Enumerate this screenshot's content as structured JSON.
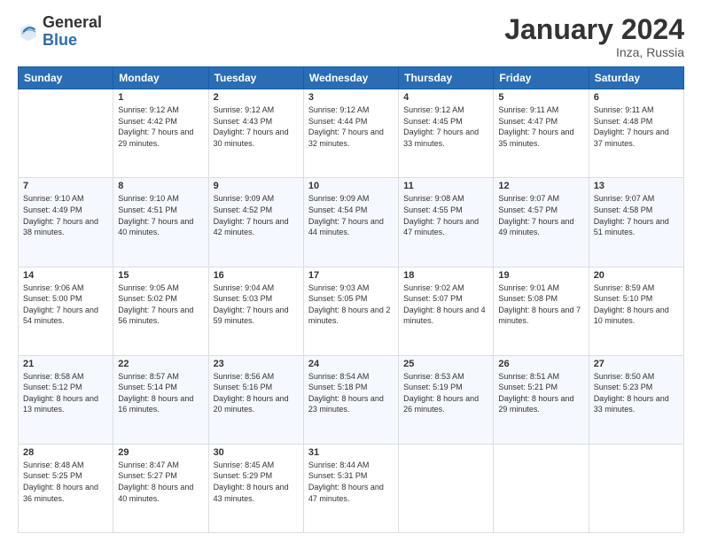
{
  "logo": {
    "general": "General",
    "blue": "Blue"
  },
  "header": {
    "month": "January 2024",
    "location": "Inza, Russia"
  },
  "weekdays": [
    "Sunday",
    "Monday",
    "Tuesday",
    "Wednesday",
    "Thursday",
    "Friday",
    "Saturday"
  ],
  "weeks": [
    [
      {
        "day": "",
        "sunrise": "",
        "sunset": "",
        "daylight": ""
      },
      {
        "day": "1",
        "sunrise": "Sunrise: 9:12 AM",
        "sunset": "Sunset: 4:42 PM",
        "daylight": "Daylight: 7 hours and 29 minutes."
      },
      {
        "day": "2",
        "sunrise": "Sunrise: 9:12 AM",
        "sunset": "Sunset: 4:43 PM",
        "daylight": "Daylight: 7 hours and 30 minutes."
      },
      {
        "day": "3",
        "sunrise": "Sunrise: 9:12 AM",
        "sunset": "Sunset: 4:44 PM",
        "daylight": "Daylight: 7 hours and 32 minutes."
      },
      {
        "day": "4",
        "sunrise": "Sunrise: 9:12 AM",
        "sunset": "Sunset: 4:45 PM",
        "daylight": "Daylight: 7 hours and 33 minutes."
      },
      {
        "day": "5",
        "sunrise": "Sunrise: 9:11 AM",
        "sunset": "Sunset: 4:47 PM",
        "daylight": "Daylight: 7 hours and 35 minutes."
      },
      {
        "day": "6",
        "sunrise": "Sunrise: 9:11 AM",
        "sunset": "Sunset: 4:48 PM",
        "daylight": "Daylight: 7 hours and 37 minutes."
      }
    ],
    [
      {
        "day": "7",
        "sunrise": "Sunrise: 9:10 AM",
        "sunset": "Sunset: 4:49 PM",
        "daylight": "Daylight: 7 hours and 38 minutes."
      },
      {
        "day": "8",
        "sunrise": "Sunrise: 9:10 AM",
        "sunset": "Sunset: 4:51 PM",
        "daylight": "Daylight: 7 hours and 40 minutes."
      },
      {
        "day": "9",
        "sunrise": "Sunrise: 9:09 AM",
        "sunset": "Sunset: 4:52 PM",
        "daylight": "Daylight: 7 hours and 42 minutes."
      },
      {
        "day": "10",
        "sunrise": "Sunrise: 9:09 AM",
        "sunset": "Sunset: 4:54 PM",
        "daylight": "Daylight: 7 hours and 44 minutes."
      },
      {
        "day": "11",
        "sunrise": "Sunrise: 9:08 AM",
        "sunset": "Sunset: 4:55 PM",
        "daylight": "Daylight: 7 hours and 47 minutes."
      },
      {
        "day": "12",
        "sunrise": "Sunrise: 9:07 AM",
        "sunset": "Sunset: 4:57 PM",
        "daylight": "Daylight: 7 hours and 49 minutes."
      },
      {
        "day": "13",
        "sunrise": "Sunrise: 9:07 AM",
        "sunset": "Sunset: 4:58 PM",
        "daylight": "Daylight: 7 hours and 51 minutes."
      }
    ],
    [
      {
        "day": "14",
        "sunrise": "Sunrise: 9:06 AM",
        "sunset": "Sunset: 5:00 PM",
        "daylight": "Daylight: 7 hours and 54 minutes."
      },
      {
        "day": "15",
        "sunrise": "Sunrise: 9:05 AM",
        "sunset": "Sunset: 5:02 PM",
        "daylight": "Daylight: 7 hours and 56 minutes."
      },
      {
        "day": "16",
        "sunrise": "Sunrise: 9:04 AM",
        "sunset": "Sunset: 5:03 PM",
        "daylight": "Daylight: 7 hours and 59 minutes."
      },
      {
        "day": "17",
        "sunrise": "Sunrise: 9:03 AM",
        "sunset": "Sunset: 5:05 PM",
        "daylight": "Daylight: 8 hours and 2 minutes."
      },
      {
        "day": "18",
        "sunrise": "Sunrise: 9:02 AM",
        "sunset": "Sunset: 5:07 PM",
        "daylight": "Daylight: 8 hours and 4 minutes."
      },
      {
        "day": "19",
        "sunrise": "Sunrise: 9:01 AM",
        "sunset": "Sunset: 5:08 PM",
        "daylight": "Daylight: 8 hours and 7 minutes."
      },
      {
        "day": "20",
        "sunrise": "Sunrise: 8:59 AM",
        "sunset": "Sunset: 5:10 PM",
        "daylight": "Daylight: 8 hours and 10 minutes."
      }
    ],
    [
      {
        "day": "21",
        "sunrise": "Sunrise: 8:58 AM",
        "sunset": "Sunset: 5:12 PM",
        "daylight": "Daylight: 8 hours and 13 minutes."
      },
      {
        "day": "22",
        "sunrise": "Sunrise: 8:57 AM",
        "sunset": "Sunset: 5:14 PM",
        "daylight": "Daylight: 8 hours and 16 minutes."
      },
      {
        "day": "23",
        "sunrise": "Sunrise: 8:56 AM",
        "sunset": "Sunset: 5:16 PM",
        "daylight": "Daylight: 8 hours and 20 minutes."
      },
      {
        "day": "24",
        "sunrise": "Sunrise: 8:54 AM",
        "sunset": "Sunset: 5:18 PM",
        "daylight": "Daylight: 8 hours and 23 minutes."
      },
      {
        "day": "25",
        "sunrise": "Sunrise: 8:53 AM",
        "sunset": "Sunset: 5:19 PM",
        "daylight": "Daylight: 8 hours and 26 minutes."
      },
      {
        "day": "26",
        "sunrise": "Sunrise: 8:51 AM",
        "sunset": "Sunset: 5:21 PM",
        "daylight": "Daylight: 8 hours and 29 minutes."
      },
      {
        "day": "27",
        "sunrise": "Sunrise: 8:50 AM",
        "sunset": "Sunset: 5:23 PM",
        "daylight": "Daylight: 8 hours and 33 minutes."
      }
    ],
    [
      {
        "day": "28",
        "sunrise": "Sunrise: 8:48 AM",
        "sunset": "Sunset: 5:25 PM",
        "daylight": "Daylight: 8 hours and 36 minutes."
      },
      {
        "day": "29",
        "sunrise": "Sunrise: 8:47 AM",
        "sunset": "Sunset: 5:27 PM",
        "daylight": "Daylight: 8 hours and 40 minutes."
      },
      {
        "day": "30",
        "sunrise": "Sunrise: 8:45 AM",
        "sunset": "Sunset: 5:29 PM",
        "daylight": "Daylight: 8 hours and 43 minutes."
      },
      {
        "day": "31",
        "sunrise": "Sunrise: 8:44 AM",
        "sunset": "Sunset: 5:31 PM",
        "daylight": "Daylight: 8 hours and 47 minutes."
      },
      {
        "day": "",
        "sunrise": "",
        "sunset": "",
        "daylight": ""
      },
      {
        "day": "",
        "sunrise": "",
        "sunset": "",
        "daylight": ""
      },
      {
        "day": "",
        "sunrise": "",
        "sunset": "",
        "daylight": ""
      }
    ]
  ]
}
